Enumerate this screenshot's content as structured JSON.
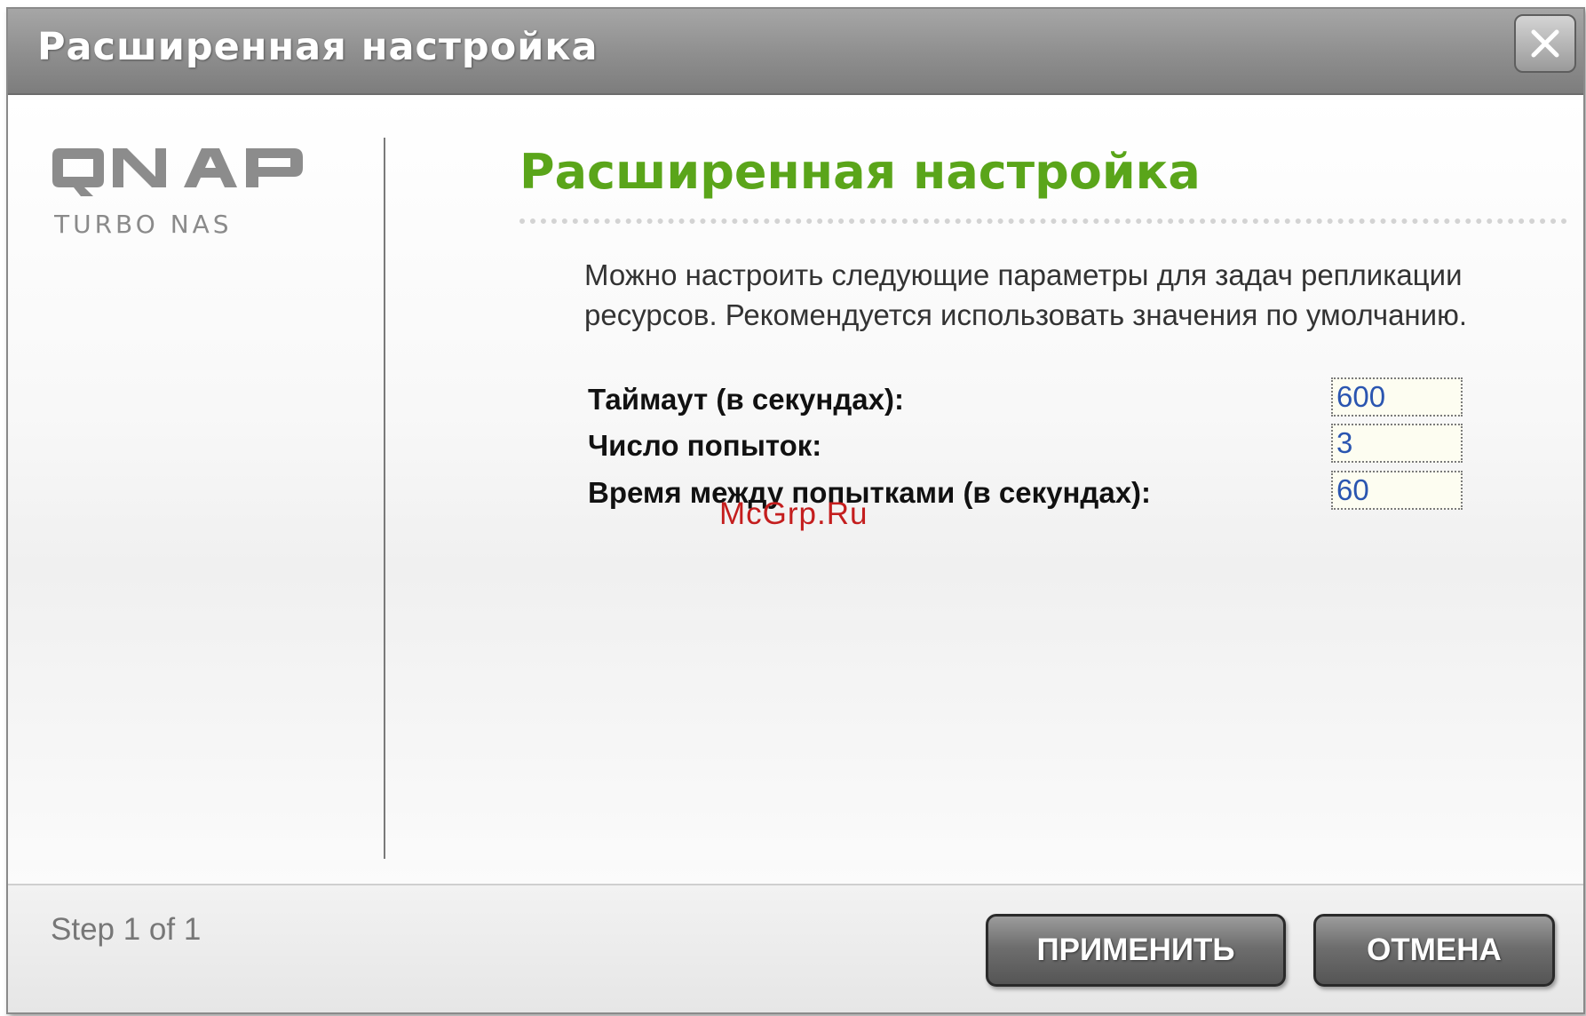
{
  "window": {
    "title": "Расширенная настройка",
    "close_icon": "close-icon"
  },
  "logo": {
    "brand": "QNAP",
    "subtitle": "Turbo NAS"
  },
  "content": {
    "heading": "Расширенная настройка",
    "description": "Можно настроить следующие параметры для задач репликации ресурсов. Рекомендуется использовать значения по умолчанию.",
    "fields": [
      {
        "label": "Таймаут (в секундах):",
        "value": "600"
      },
      {
        "label": "Число попыток:",
        "value": "3"
      },
      {
        "label": "Время между попытками (в секундах):",
        "value": "60"
      }
    ],
    "watermark": "McGrp.Ru"
  },
  "footer": {
    "step": "Step 1 of 1",
    "apply_label": "ПРИМЕНИТЬ",
    "cancel_label": "ОТМЕНА"
  },
  "colors": {
    "heading": "#5aa51a",
    "input_text": "#2a55b0",
    "watermark": "#c41e1e"
  }
}
